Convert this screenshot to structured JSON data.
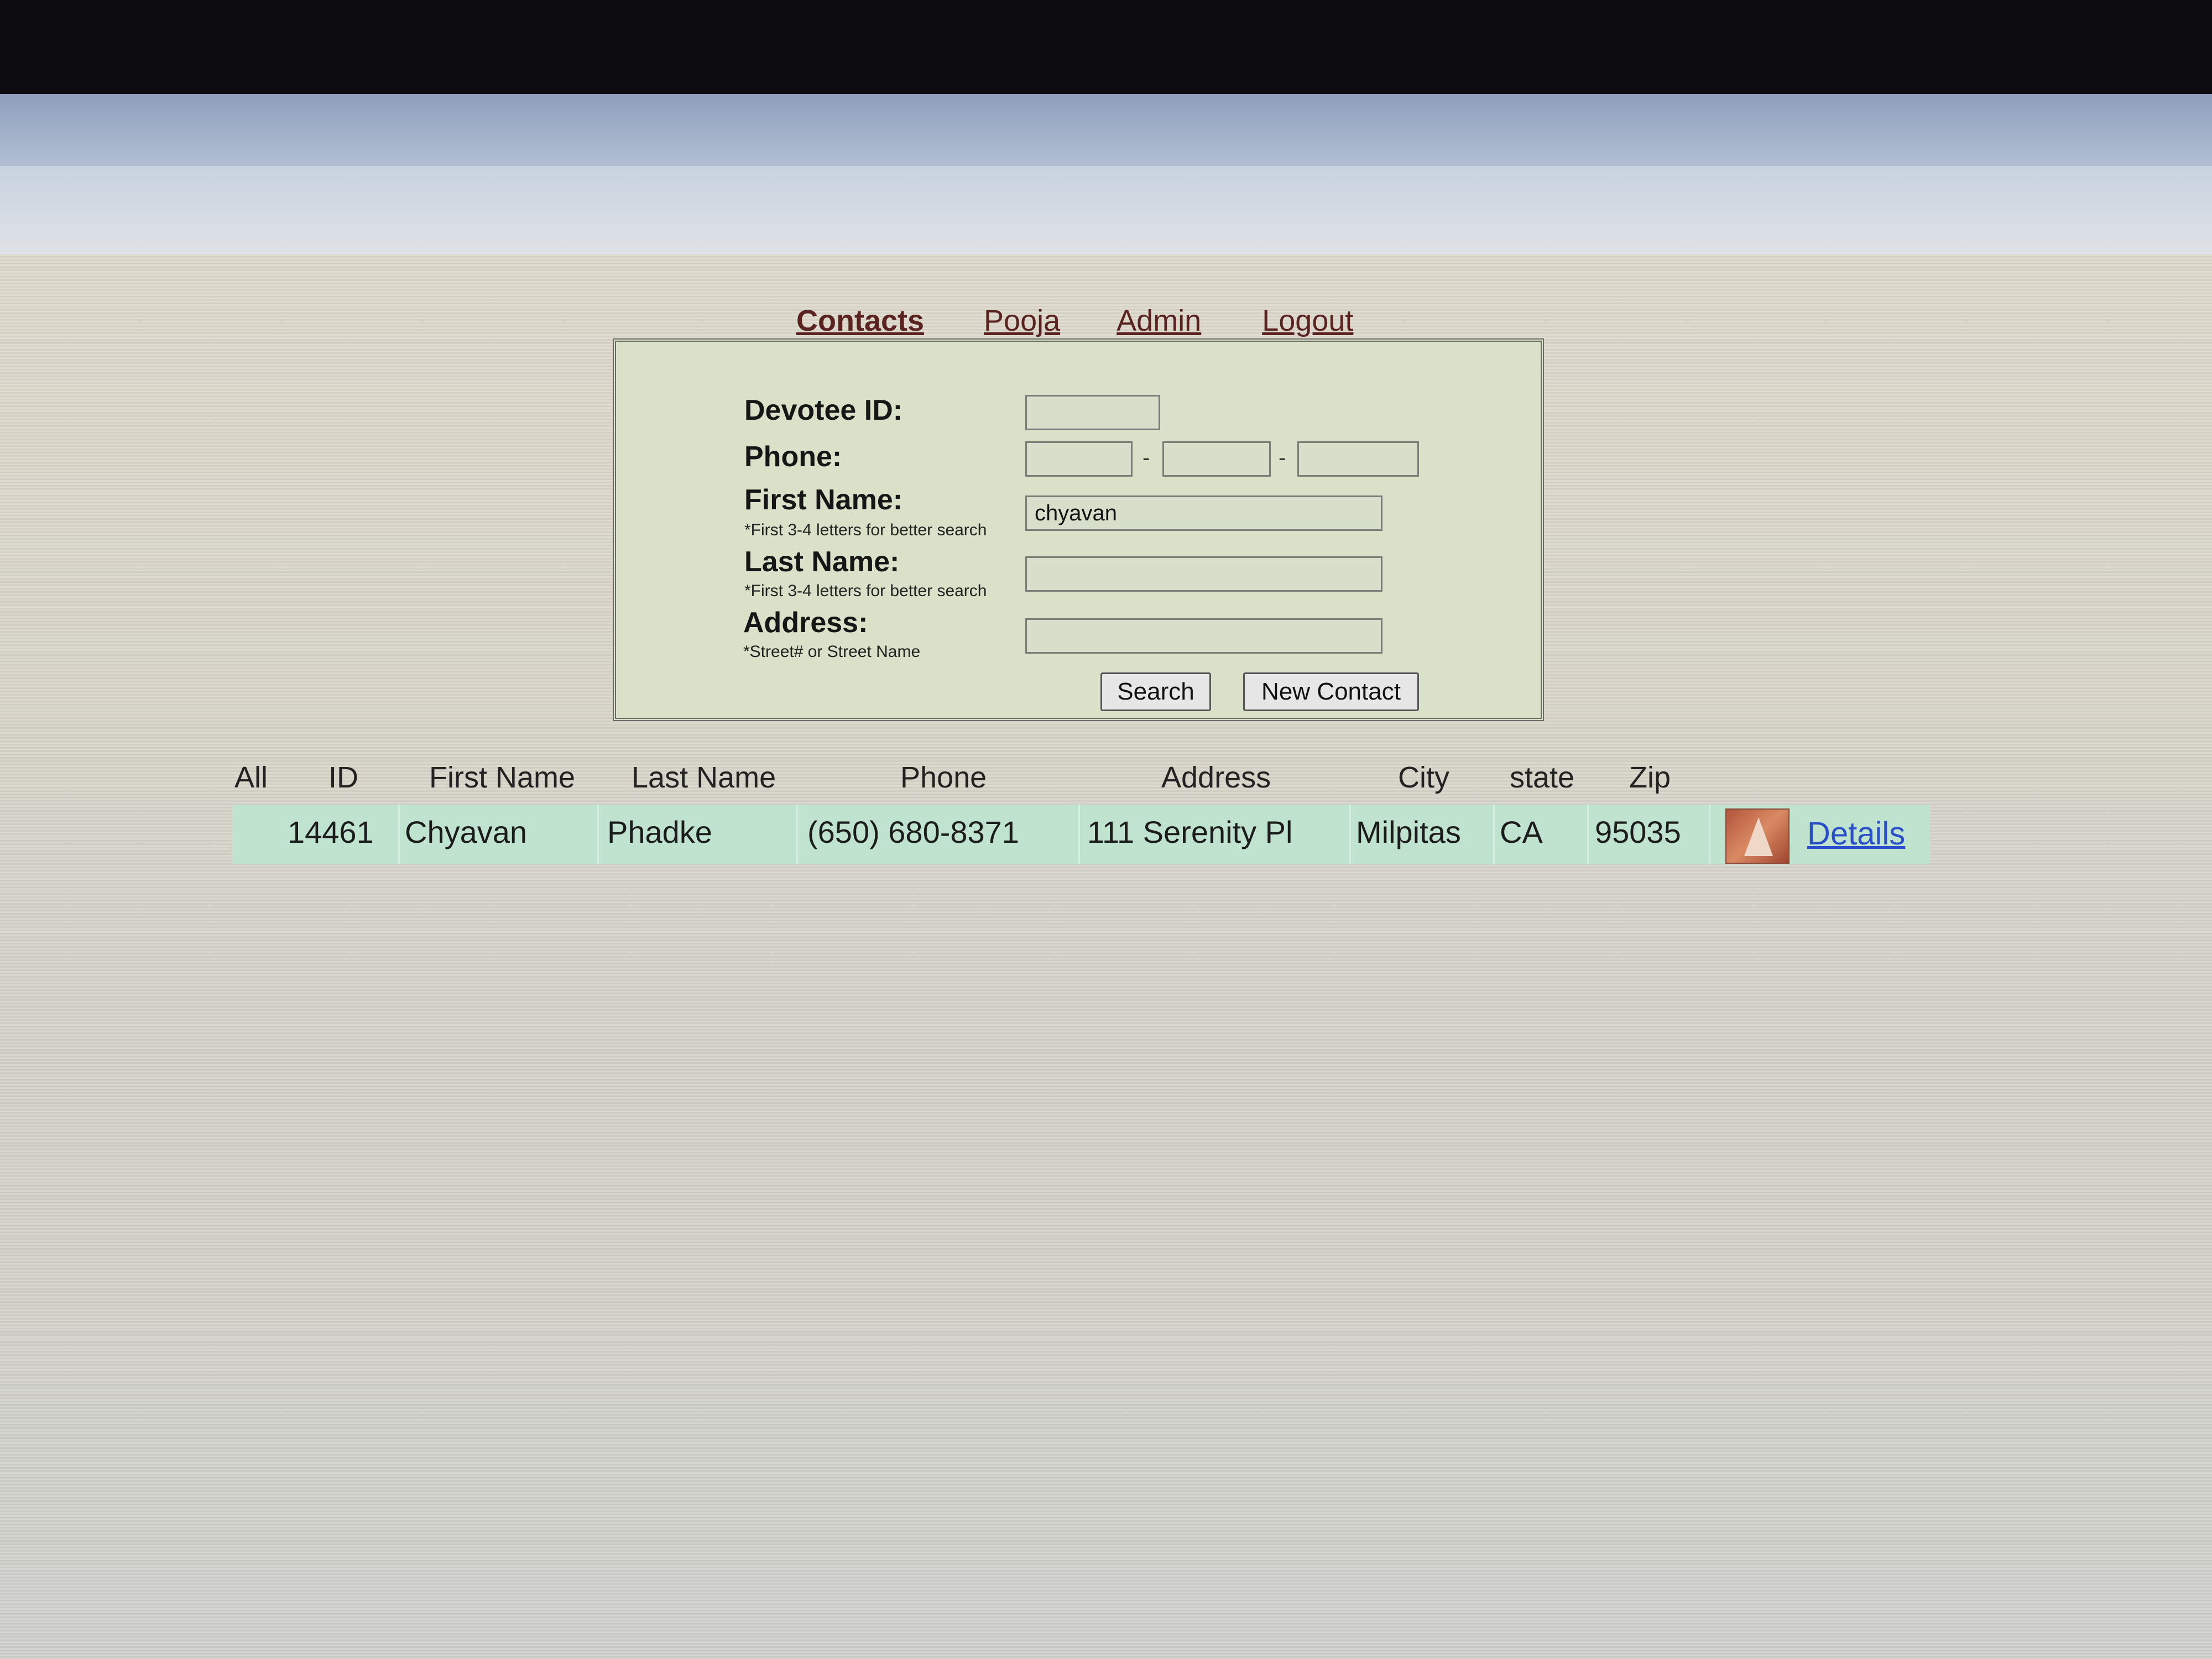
{
  "nav": {
    "contacts": "Contacts",
    "pooja": "Pooja",
    "admin": "Admin",
    "logout": "Logout"
  },
  "search_form": {
    "devotee_id_label": "Devotee ID:",
    "devotee_id_value": "",
    "phone_label": "Phone:",
    "phone_part1": "",
    "phone_part2": "",
    "phone_part3": "",
    "phone_separator": "-",
    "first_name_label": "First Name:",
    "first_name_hint": "*First 3-4 letters for better search",
    "first_name_value": "chyavan",
    "last_name_label": "Last Name:",
    "last_name_hint": "*First 3-4 letters for better search",
    "last_name_value": "",
    "address_label": "Address:",
    "address_hint": "*Street# or Street Name",
    "address_value": "",
    "search_button": "Search",
    "new_contact_button": "New Contact"
  },
  "results": {
    "columns": [
      "All",
      "ID",
      "First Name",
      "Last Name",
      "Phone",
      "Address",
      "City",
      "state",
      "Zip"
    ],
    "rows": [
      {
        "id": "14461",
        "first_name": "Chyavan",
        "last_name": "Phadke",
        "phone": "(650) 680-8371",
        "address": "111 Serenity Pl",
        "city": "Milpitas",
        "state": "CA",
        "zip": "95035",
        "details_link": "Details"
      }
    ]
  },
  "colors": {
    "nav_link": "#5a2320",
    "panel_bg": "#d9e2c8",
    "row_bg": "#bfe3cf",
    "details_link": "#2b4fc9"
  }
}
